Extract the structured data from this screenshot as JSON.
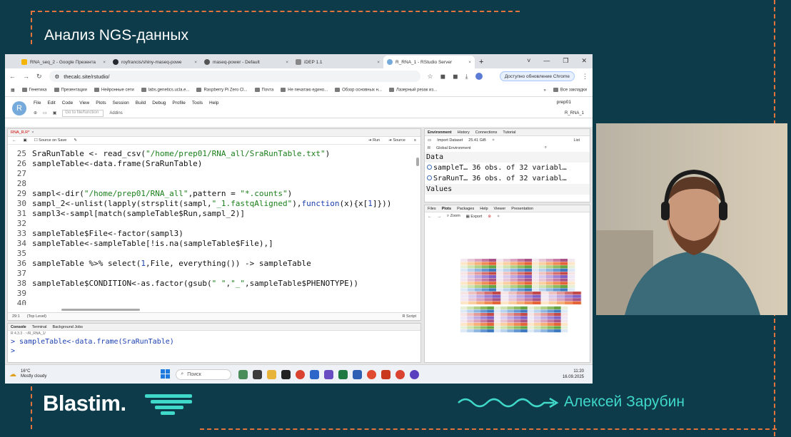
{
  "slide": {
    "title": "Анализ NGS-данных"
  },
  "browser": {
    "tabs": [
      {
        "label": "RNA_seq_2 - Google Презента",
        "color": "#f4b400"
      },
      {
        "label": "royfrancis/shiny-maseq-powe",
        "color": "#24292f"
      },
      {
        "label": "maseq-power - Default",
        "color": "#555555"
      },
      {
        "label": "iDEP 1.1",
        "color": "#888888"
      },
      {
        "label": "R_RNA_1 - RStudio Server",
        "color": "#75aadb"
      }
    ],
    "window_controls": [
      "˅",
      "—",
      "❐",
      "✕"
    ],
    "url": "thecalc.site/rstudio/",
    "update_label": "Доступно обновление Chrome",
    "bookmarks": [
      "Генетика",
      "Презентации",
      "Нейронные сети",
      "labs.genetics.ucla.e...",
      "Raspberry Pi Zero Cl...",
      "Почта",
      "Не печатаю едино...",
      "Обзор основных н...",
      "Лазерный резак из..."
    ],
    "bookmarks_more": "»",
    "all_bookmarks": "Все закладки"
  },
  "rstudio": {
    "logo": "R",
    "menu": [
      "File",
      "Edit",
      "Code",
      "View",
      "Plots",
      "Session",
      "Build",
      "Debug",
      "Profile",
      "Tools",
      "Help"
    ],
    "user": "prep01",
    "goto_placeholder": "Go to file/function",
    "addins": "Addins",
    "project": "R_RNA_1",
    "editor": {
      "tab": "RNA_R.R*",
      "source_on_save": "Source on Save",
      "run": "Run",
      "source": "Source",
      "status_pos": "29:1",
      "status_level": "(Top Level)",
      "status_type": "R Script",
      "lines": [
        {
          "n": "25",
          "segments": [
            {
              "t": "SraRunTable <- read_csv(",
              "c": ""
            },
            {
              "t": "\"/home/prep01/RNA_all/SraRunTable.txt\"",
              "c": "str"
            },
            {
              "t": ")",
              "c": ""
            }
          ]
        },
        {
          "n": "26",
          "segments": [
            {
              "t": "sampleTable<-data.frame(SraRunTable)",
              "c": ""
            }
          ]
        },
        {
          "n": "27",
          "segments": [
            {
              "t": "",
              "c": ""
            }
          ]
        },
        {
          "n": "28",
          "segments": [
            {
              "t": "",
              "c": ""
            }
          ]
        },
        {
          "n": "29",
          "segments": [
            {
              "t": "sampl<-dir(",
              "c": ""
            },
            {
              "t": "\"/home/prep01/RNA_all\"",
              "c": "str"
            },
            {
              "t": ",pattern = ",
              "c": ""
            },
            {
              "t": "\"*.counts\"",
              "c": "str"
            },
            {
              "t": ")",
              "c": ""
            }
          ]
        },
        {
          "n": "30",
          "segments": [
            {
              "t": "sampl_2<-unlist(lapply(strsplit(sampl,",
              "c": ""
            },
            {
              "t": "\"_1.fastqAligned\"",
              "c": "str"
            },
            {
              "t": "),",
              "c": ""
            },
            {
              "t": "function",
              "c": "kw"
            },
            {
              "t": "(x){x[",
              "c": ""
            },
            {
              "t": "1",
              "c": "kw"
            },
            {
              "t": "]}))",
              "c": ""
            }
          ]
        },
        {
          "n": "31",
          "segments": [
            {
              "t": "sampl3<-sampl[match(sampleTable$Run,sampl_2)]",
              "c": ""
            }
          ]
        },
        {
          "n": "32",
          "segments": [
            {
              "t": "",
              "c": ""
            }
          ]
        },
        {
          "n": "33",
          "segments": [
            {
              "t": "sampleTable$File<-factor(sampl3)",
              "c": ""
            }
          ]
        },
        {
          "n": "34",
          "segments": [
            {
              "t": "sampleTable<-sampleTable[!is.na(sampleTable$File),]",
              "c": ""
            }
          ]
        },
        {
          "n": "35",
          "segments": [
            {
              "t": "",
              "c": ""
            }
          ]
        },
        {
          "n": "36",
          "segments": [
            {
              "t": "sampleTable %>% select(",
              "c": ""
            },
            {
              "t": "1",
              "c": "kw"
            },
            {
              "t": ",File, everything()) -> sampleTable",
              "c": ""
            }
          ]
        },
        {
          "n": "37",
          "segments": [
            {
              "t": "",
              "c": ""
            }
          ]
        },
        {
          "n": "38",
          "segments": [
            {
              "t": "sampleTable$CONDITION<-as.factor(gsub(",
              "c": ""
            },
            {
              "t": "\" \"",
              "c": "str"
            },
            {
              "t": ",",
              "c": ""
            },
            {
              "t": "\"_\"",
              "c": "str"
            },
            {
              "t": ",sampleTable$PHENOTYPE))",
              "c": ""
            }
          ]
        },
        {
          "n": "39",
          "segments": [
            {
              "t": "",
              "c": ""
            }
          ]
        },
        {
          "n": "40",
          "segments": [
            {
              "t": "",
              "c": ""
            }
          ]
        }
      ]
    },
    "console": {
      "tabs": [
        "Console",
        "Terminal",
        "Background Jobs"
      ],
      "path": "R 4.3.3 · ~/R_RNA_1/",
      "lines": [
        "> sampleTable<-data.frame(SraRunTable)",
        ">"
      ]
    },
    "environment": {
      "tabs": [
        "Environment",
        "History",
        "Connections",
        "Tutorial"
      ],
      "import": "Import Dataset",
      "memory": "25.41 GiB",
      "list": "List",
      "scope": "Global Environment",
      "data_header": "Data",
      "rows": [
        {
          "name": "sampleT…",
          "desc": "36 obs. of 32 variabl…"
        },
        {
          "name": "SraRunT…",
          "desc": "36 obs. of 32 variabl…"
        }
      ],
      "values_header": "Values"
    },
    "plots": {
      "tabs": [
        "Files",
        "Plots",
        "Packages",
        "Help",
        "Viewer",
        "Presentation"
      ],
      "zoom": "Zoom",
      "export": "Export"
    }
  },
  "taskbar": {
    "temp": "16°C",
    "weather": "Mostly cloudy",
    "search": "Поиск",
    "time": "11:20",
    "date": "16.09.2025"
  },
  "footer": {
    "brand": "Blastim.",
    "presenter": "Алексей Зарубин"
  },
  "colors": {
    "background": "#0e3b4a",
    "accent_orange": "#e2733a",
    "accent_teal": "#3fd8c9"
  }
}
